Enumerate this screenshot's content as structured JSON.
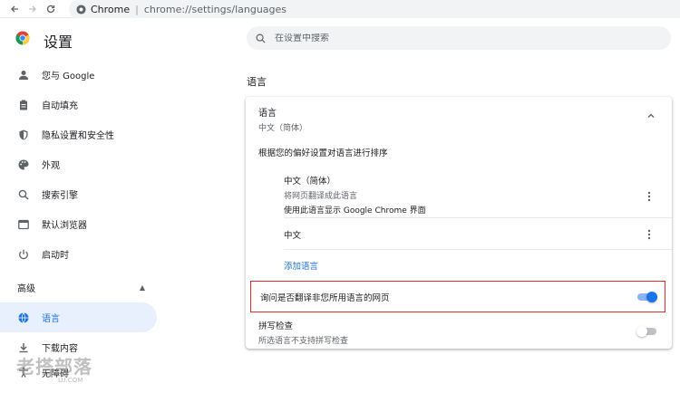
{
  "browser": {
    "site_name": "Chrome",
    "url": "chrome://settings/languages"
  },
  "header": {
    "title": "设置",
    "search_placeholder": "在设置中搜索"
  },
  "sidebar": {
    "items": [
      {
        "label": "您与 Google",
        "icon": "person-icon"
      },
      {
        "label": "自动填充",
        "icon": "clipboard-icon"
      },
      {
        "label": "隐私设置和安全性",
        "icon": "shield-icon"
      },
      {
        "label": "外观",
        "icon": "palette-icon"
      },
      {
        "label": "搜索引擎",
        "icon": "search-icon"
      },
      {
        "label": "默认浏览器",
        "icon": "browser-icon"
      },
      {
        "label": "启动时",
        "icon": "power-icon"
      }
    ],
    "advanced_label": "高级",
    "advanced_items": [
      {
        "label": "语言",
        "icon": "globe-icon",
        "active": true
      },
      {
        "label": "下载内容",
        "icon": "download-icon"
      },
      {
        "label": "无障碍",
        "icon": "accessibility-icon"
      }
    ]
  },
  "main": {
    "section_title": "语言",
    "languages_card": {
      "header_title": "语言",
      "header_subtitle": "中文（简体）",
      "order_text": "根据您的偏好设置对语言进行排序",
      "languages": [
        {
          "name": "中文（简体）",
          "line1": "将网页翻译成此语言",
          "line2": "使用此语言显示 Google Chrome 界面"
        },
        {
          "name": "中文"
        }
      ],
      "add_language": "添加语言",
      "ask_translate": "询问是否翻译非您所用语言的网页",
      "ask_translate_enabled": true,
      "spellcheck_title": "拼写检查",
      "spellcheck_subtitle": "所选语言不支持拼写检查",
      "spellcheck_enabled": false
    }
  },
  "watermark": {
    "text": "老搭部落",
    "small": "LU.COM"
  },
  "colors": {
    "accent": "#1a73e8",
    "active_bg": "#e8f0fe",
    "highlight_border": "#d93025"
  }
}
